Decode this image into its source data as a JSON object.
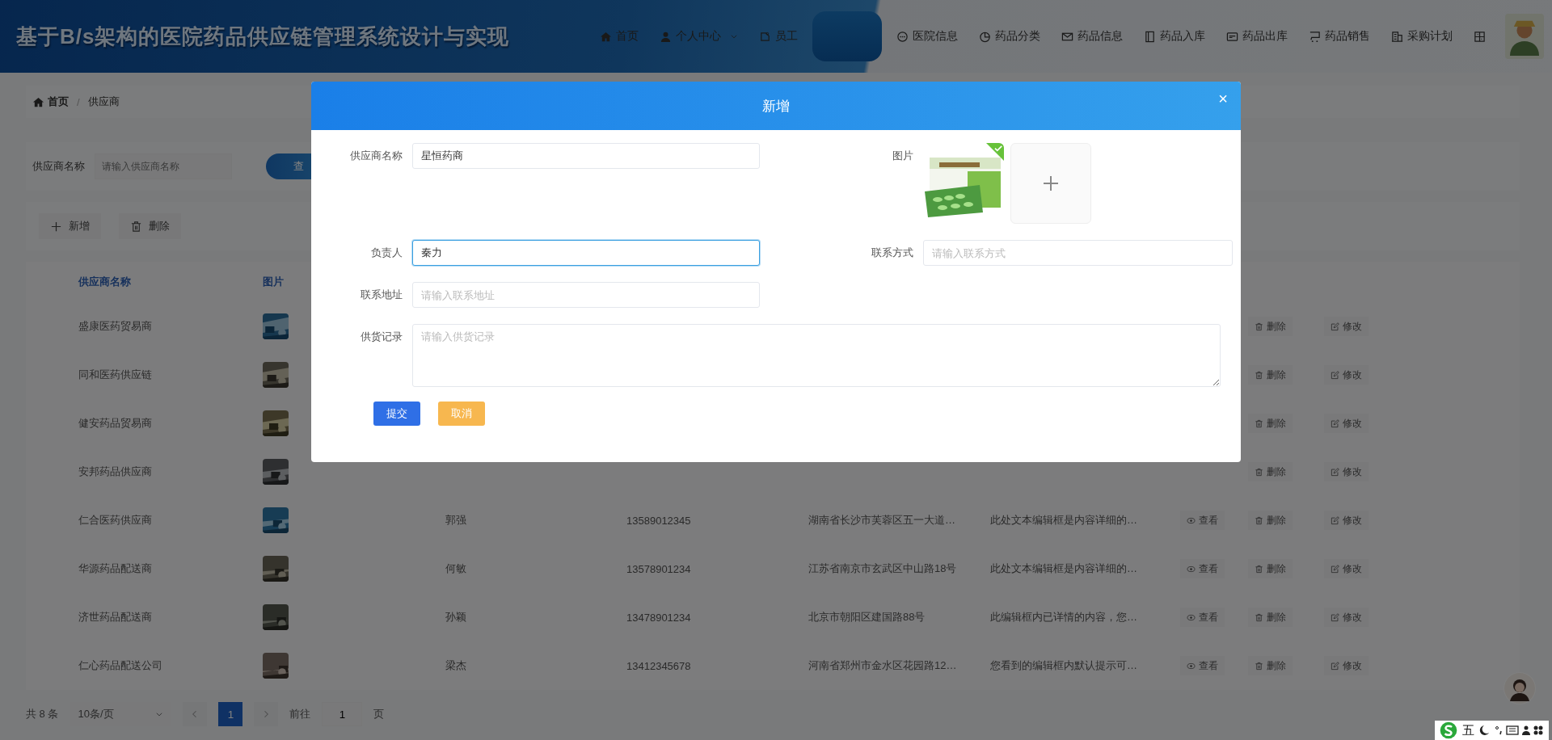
{
  "header": {
    "title": "基于B/s架构的医院药品供应链管理系统设计与实现",
    "nav": [
      {
        "label": "首页",
        "kind": "home",
        "selected": false
      },
      {
        "label": "个人中心",
        "kind": "user",
        "selected": false,
        "caret": true
      },
      {
        "label": "员工",
        "kind": "tag",
        "selected": false
      },
      {
        "kind": "blank",
        "selected": true
      },
      {
        "label": "医院信息",
        "kind": "chat",
        "selected": false
      },
      {
        "label": "药品分类",
        "kind": "pie",
        "selected": false
      },
      {
        "label": "药品信息",
        "kind": "mail",
        "selected": false
      },
      {
        "label": "药品入库",
        "kind": "book",
        "selected": false
      },
      {
        "label": "药品出库",
        "kind": "card",
        "selected": false
      },
      {
        "label": "药品销售",
        "kind": "cart",
        "selected": false
      },
      {
        "label": "采购计划",
        "kind": "building",
        "selected": false
      },
      {
        "kind": "grid",
        "selected": false
      }
    ]
  },
  "breadcrumb": {
    "separator": "/",
    "items": [
      {
        "label": "首页",
        "kind": "home"
      },
      {
        "label": "供应商",
        "kind": "text"
      }
    ]
  },
  "search": {
    "label": "供应商名称",
    "placeholder": "请输入供应商名称",
    "button": "查"
  },
  "toolbar": [
    {
      "label": "新增",
      "kind": "add"
    },
    {
      "label": "删除",
      "kind": "delete"
    }
  ],
  "table": {
    "columns": [
      "供应商名称",
      "图片"
    ],
    "rows": [
      {
        "name": "盛康医药贸易商",
        "image": {
          "kind": "picture"
        },
        "actions": [
          {
            "kind": "delete",
            "label": "删除"
          },
          {
            "kind": "edit",
            "label": "修改"
          }
        ]
      },
      {
        "name": "同和医药供应链",
        "image": {
          "kind": "picture"
        },
        "actions": [
          {
            "kind": "delete",
            "label": "删除"
          },
          {
            "kind": "edit",
            "label": "修改"
          }
        ]
      },
      {
        "name": "健安药品贸易商",
        "image": {
          "kind": "picture"
        },
        "actions": [
          {
            "kind": "delete",
            "label": "删除"
          },
          {
            "kind": "edit",
            "label": "修改"
          }
        ]
      },
      {
        "name": "安邦药品供应商",
        "image": {
          "kind": "picture"
        },
        "actions": [
          {
            "kind": "delete",
            "label": "删除"
          },
          {
            "kind": "edit",
            "label": "修改"
          }
        ]
      },
      {
        "name": "仁合医药供应商",
        "image": {
          "kind": "picture"
        },
        "person": "郭强",
        "phone": "13589012345",
        "address": "湖南省长沙市芙蓉区五一大道…",
        "record": "此处文本编辑框是内容详细的…",
        "actions": [
          {
            "kind": "view",
            "label": "查看"
          },
          {
            "kind": "delete",
            "label": "删除"
          },
          {
            "kind": "edit",
            "label": "修改"
          }
        ]
      },
      {
        "name": "华源药品配送商",
        "image": {
          "kind": "picture"
        },
        "person": "何敏",
        "phone": "13578901234",
        "address": "江苏省南京市玄武区中山路18号",
        "record": "此处文本编辑框是内容详细的…",
        "actions": [
          {
            "kind": "view",
            "label": "查看"
          },
          {
            "kind": "delete",
            "label": "删除"
          },
          {
            "kind": "edit",
            "label": "修改"
          }
        ]
      },
      {
        "name": "济世药品配送商",
        "image": {
          "kind": "picture"
        },
        "person": "孙颖",
        "phone": "13478901234",
        "address": "北京市朝阳区建国路88号",
        "record": "此编辑框内已详情的内容，您…",
        "actions": [
          {
            "kind": "view",
            "label": "查看"
          },
          {
            "kind": "delete",
            "label": "删除"
          },
          {
            "kind": "edit",
            "label": "修改"
          }
        ]
      },
      {
        "name": "仁心药品配送公司",
        "image": {
          "kind": "picture"
        },
        "person": "梁杰",
        "phone": "13412345678",
        "address": "河南省郑州市金水区花园路12…",
        "record": "您看到的编辑框内默认提示可…",
        "actions": [
          {
            "kind": "view",
            "label": "查看"
          },
          {
            "kind": "delete",
            "label": "删除"
          },
          {
            "kind": "edit",
            "label": "修改"
          }
        ]
      }
    ]
  },
  "pagination": {
    "total": "共 8 条",
    "page_size": "10条/页",
    "pages": [
      {
        "label": "1",
        "selected": true
      }
    ],
    "goto_label": "前往",
    "goto_value": "1",
    "goto_suffix": "页"
  },
  "dialog": {
    "title": "新增",
    "close": "×",
    "fields": [
      {
        "kind": "input",
        "label": "供应商名称",
        "value": "星恒药商",
        "focused": false
      },
      {
        "kind": "upload",
        "label": "图片",
        "image": {
          "kind": "picture"
        },
        "uploaded": true
      },
      {
        "kind": "input",
        "label": "负责人",
        "value": "秦力",
        "focused": true
      },
      {
        "kind": "input",
        "label": "联系方式",
        "placeholder": "请输入联系方式",
        "focused": false
      },
      {
        "kind": "input",
        "label": "联系地址",
        "placeholder": "请输入联系地址",
        "focused": false
      },
      {
        "kind": "textarea",
        "label": "供货记录",
        "placeholder": "请输入供货记录",
        "focused": false
      }
    ],
    "buttons": [
      {
        "kind": "primary",
        "label": "提交"
      },
      {
        "kind": "warning",
        "label": "取消"
      }
    ]
  },
  "ime_bar": {
    "mode": "五"
  }
}
